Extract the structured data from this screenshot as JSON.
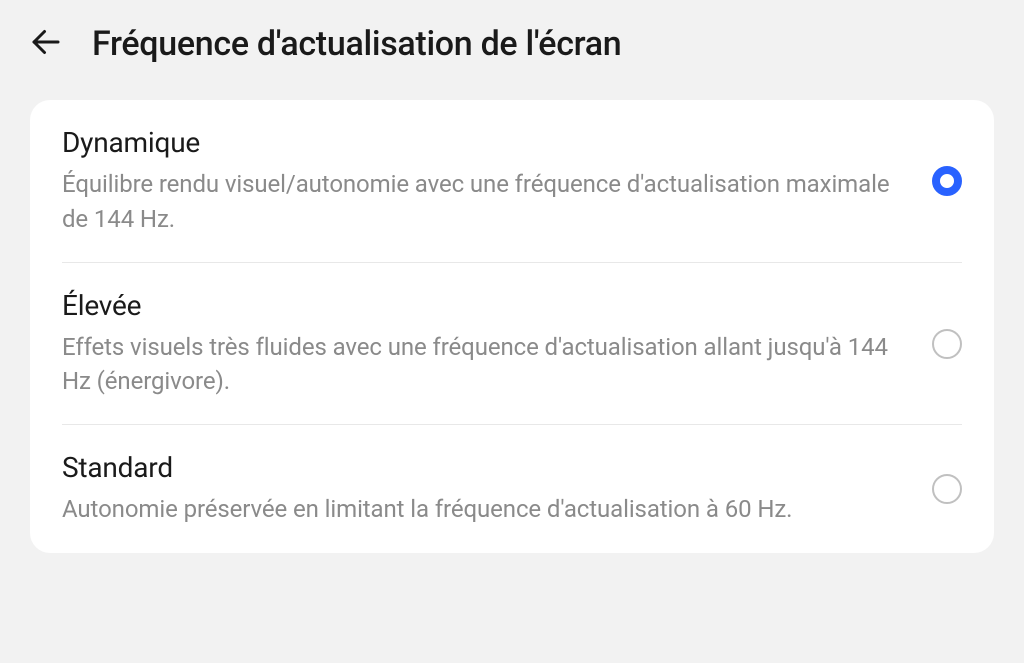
{
  "header": {
    "title": "Fréquence d'actualisation de l'écran"
  },
  "options": [
    {
      "title": "Dynamique",
      "description": "Équilibre rendu visuel/autonomie avec une fréquence d'actualisation maximale de 144 Hz.",
      "selected": true
    },
    {
      "title": "Élevée",
      "description": "Effets visuels très fluides avec une fréquence d'actualisation allant jusqu'à 144 Hz (énergivore).",
      "selected": false
    },
    {
      "title": "Standard",
      "description": "Autonomie préservée en limitant la fréquence d'actualisation à 60 Hz.",
      "selected": false
    }
  ]
}
